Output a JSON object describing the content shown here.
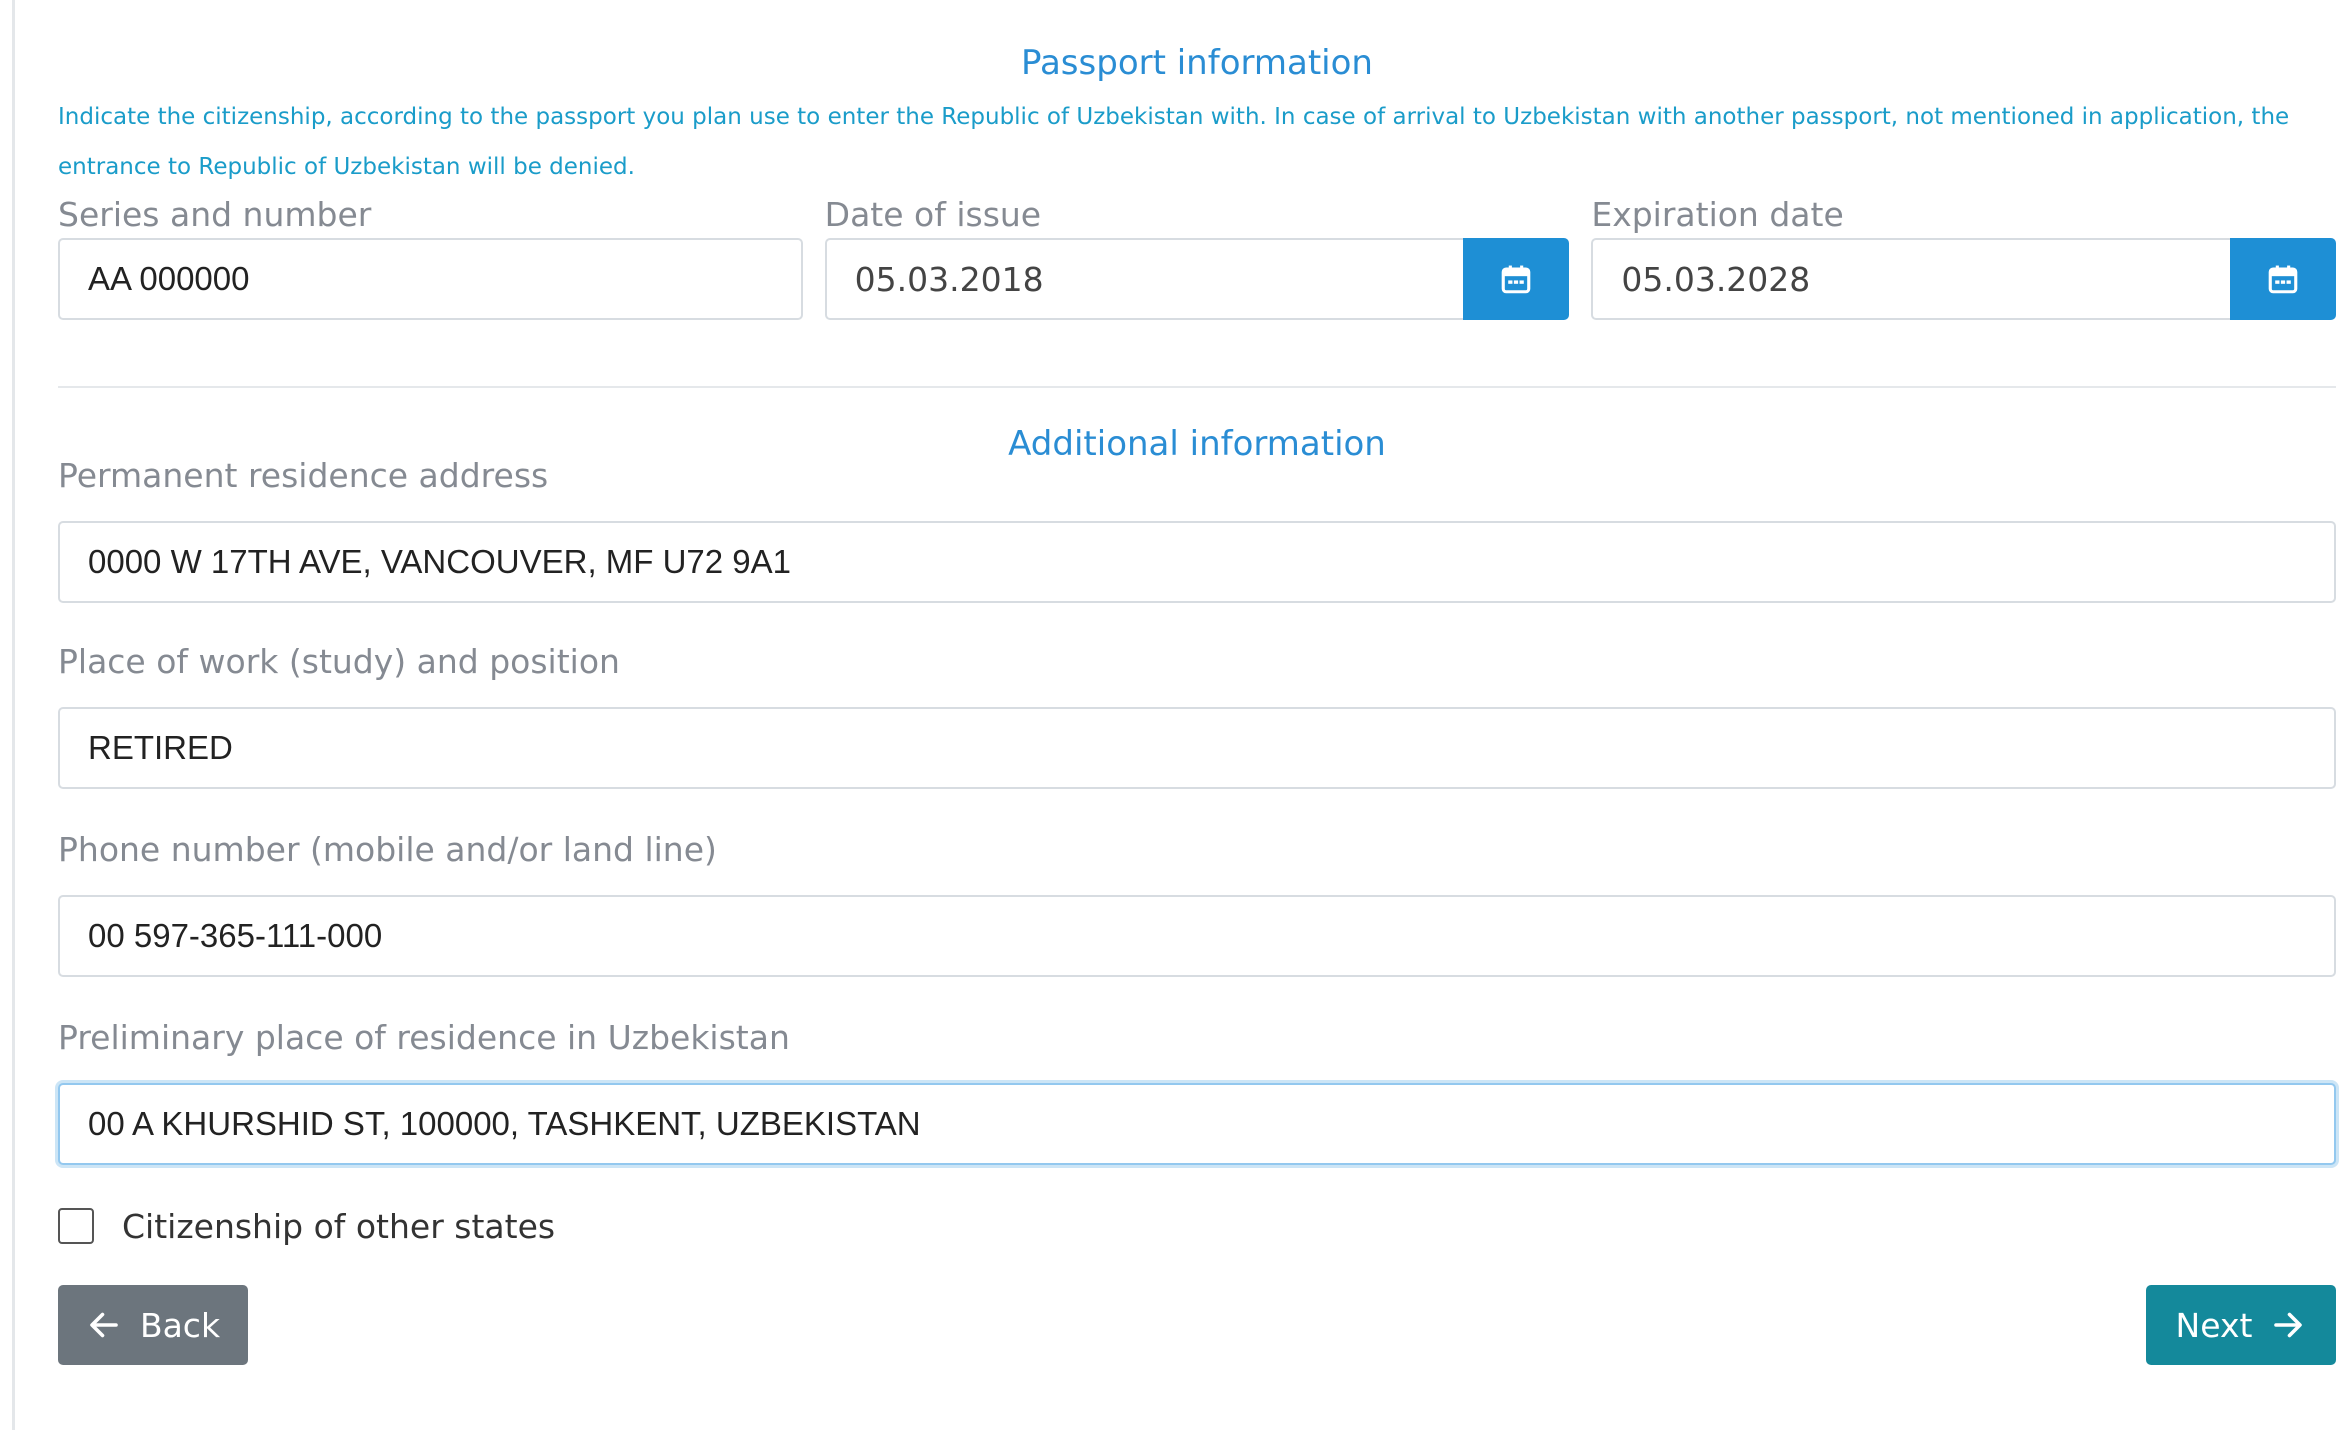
{
  "passport": {
    "title": "Passport information",
    "notice": "Indicate the citizenship, according to the passport you plan use to enter the Republic of Uzbekistan with. In case of arrival to Uzbekistan with another passport, not mentioned in application, the entrance to Republic of Uzbekistan will be denied.",
    "series_label": "Series and number",
    "series_value": "AA 000000",
    "issue_label": "Date of issue",
    "issue_value": "05.03.2018",
    "expiry_label": "Expiration date",
    "expiry_value": "05.03.2028",
    "calendar_icon": "calendar-icon"
  },
  "additional": {
    "title": "Additional information",
    "address_label": "Permanent residence address",
    "address_value": "0000 W 17TH AVE, VANCOUVER, MF U72 9A1",
    "work_label": "Place of work (study) and position",
    "work_value": "RETIRED",
    "phone_label": "Phone number (mobile and/or land line)",
    "phone_value": "00 597-365-111-000",
    "residence_label": "Preliminary place of residence in Uzbekistan",
    "residence_value": "00 A KHURSHID ST, 100000, TASHKENT, UZBEKISTAN",
    "citizenship_label": "Citizenship of other states",
    "citizenship_checked": false
  },
  "nav": {
    "back_label": "Back",
    "next_label": "Next",
    "back_icon": "arrow-left-icon",
    "next_icon": "arrow-right-icon"
  },
  "colors": {
    "accent": "#1e8fd5",
    "notice": "#1a9cc9",
    "back_button": "#6c757d",
    "next_button": "#14899b"
  }
}
